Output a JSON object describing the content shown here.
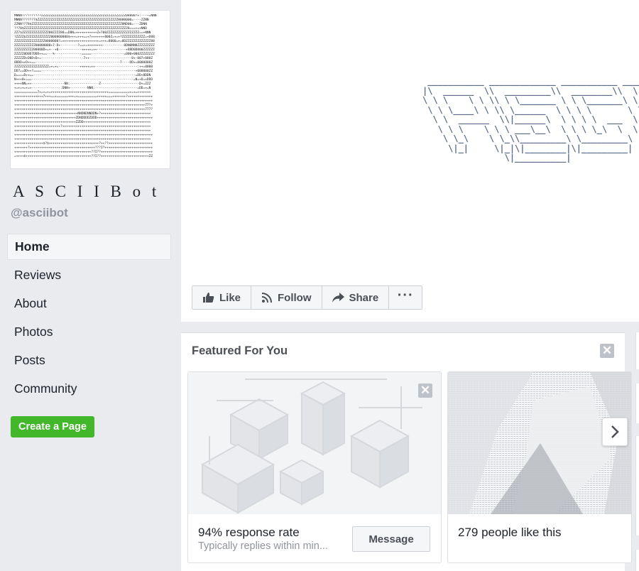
{
  "sidebar": {
    "page_name": "A S C I I  B o t",
    "username": "@asciibot",
    "nav": [
      {
        "label": "Home",
        "active": true
      },
      {
        "label": "Reviews",
        "active": false
      },
      {
        "label": "About",
        "active": false
      },
      {
        "label": "Photos",
        "active": false
      },
      {
        "label": "Posts",
        "active": false
      },
      {
        "label": "Community",
        "active": false
      }
    ],
    "create_page_label": "Create a Page"
  },
  "actions": {
    "like_label": "Like",
    "follow_label": "Follow",
    "share_label": "Share",
    "more_label": "···"
  },
  "featured": {
    "title": "Featured For You",
    "cards": [
      {
        "headline": "94% response rate",
        "subtext": "Typically replies within min...",
        "button_label": "Message"
      },
      {
        "headline": "279 people like this"
      }
    ]
  },
  "colors": {
    "brand_green": "#42b72a",
    "page_bg": "#e9ebee",
    "muted_text": "#90949c"
  },
  "icons": [
    "thumbs-up-icon",
    "rss-follow-icon",
    "share-arrow-icon",
    "more-dots-icon",
    "close-icon",
    "chevron-right-icon"
  ]
}
